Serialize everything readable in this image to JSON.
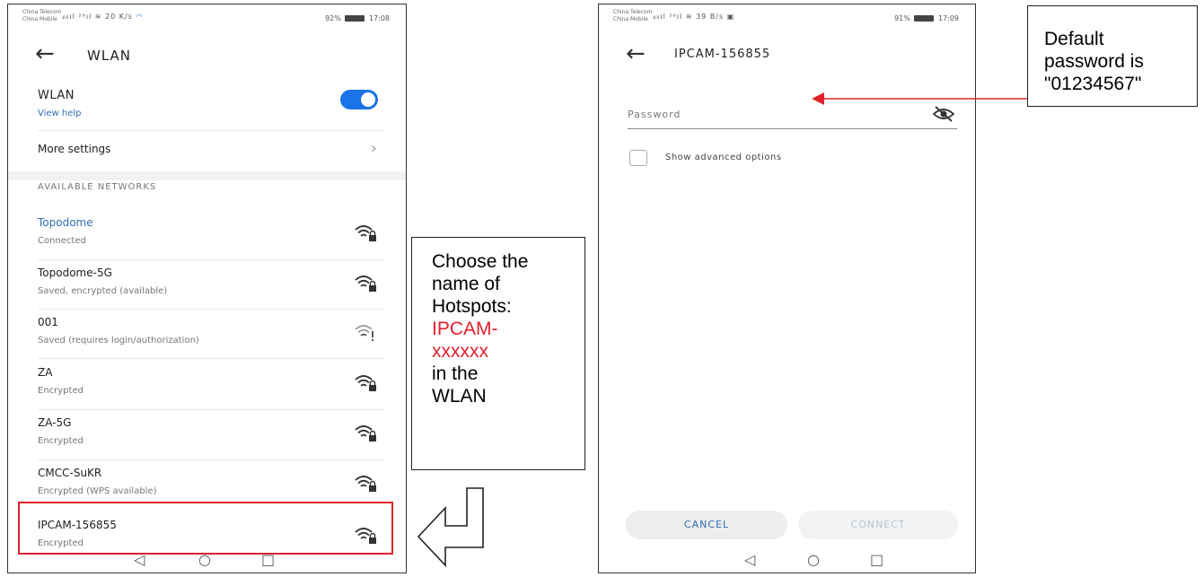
{
  "left_screen": {
    "status": {
      "carrier1": "China Telecom",
      "carrier2": "China Mobile",
      "net_speed_value": "20",
      "net_speed_unit": "K/s",
      "battery": "92%",
      "time": "17:08"
    },
    "header": {
      "title": "WLAN"
    },
    "wlan_toggle": {
      "label": "WLAN",
      "help_link": "View help",
      "on": true
    },
    "more_settings": {
      "label": "More settings"
    },
    "section_title": "AVAILABLE NETWORKS",
    "networks": [
      {
        "name": "Topodome",
        "status": "Connected",
        "icon": "wifi-lock-icon"
      },
      {
        "name": "Topodome-5G",
        "status": "Saved, encrypted (available)",
        "icon": "wifi-lock-icon"
      },
      {
        "name": "001",
        "status": "Saved (requires login/authorization)",
        "icon": "wifi-alert-icon"
      },
      {
        "name": "ZA",
        "status": "Encrypted",
        "icon": "wifi-lock-icon"
      },
      {
        "name": "ZA-5G",
        "status": "Encrypted",
        "icon": "wifi-lock-icon"
      },
      {
        "name": "CMCC-SuKR",
        "status": "Encrypted (WPS available)",
        "icon": "wifi-lock-icon"
      },
      {
        "name": "IPCAM-156855",
        "status": "Encrypted",
        "icon": "wifi-lock-icon"
      }
    ],
    "nav": {
      "back": "◁",
      "home": "○",
      "recents": "□"
    }
  },
  "right_screen": {
    "status": {
      "carrier1": "China Telecom",
      "carrier2": "China Mobile",
      "net_speed_value": "39",
      "net_speed_unit": "B/s",
      "battery": "91%",
      "time": "17:09"
    },
    "header": {
      "title": "IPCAM-156855"
    },
    "password_placeholder": "Password",
    "advanced_label": "Show advanced options",
    "cancel_label": "CANCEL",
    "connect_label": "CONNECT",
    "nav": {
      "back": "◁",
      "home": "○",
      "recents": "□"
    }
  },
  "callout_left": {
    "line1": "Choose the",
    "line2": "name of",
    "line3": "Hotspots:",
    "line4": "IPCAM-",
    "line5": "xxxxxx",
    "line6": "in the",
    "line7": "WLAN"
  },
  "callout_right": {
    "line1": "Default",
    "line2": "password is",
    "line3": "\"01234567\""
  },
  "colors": {
    "accent": "#1a73e8",
    "highlight": "#e0202c",
    "link": "#2f6fb5"
  }
}
